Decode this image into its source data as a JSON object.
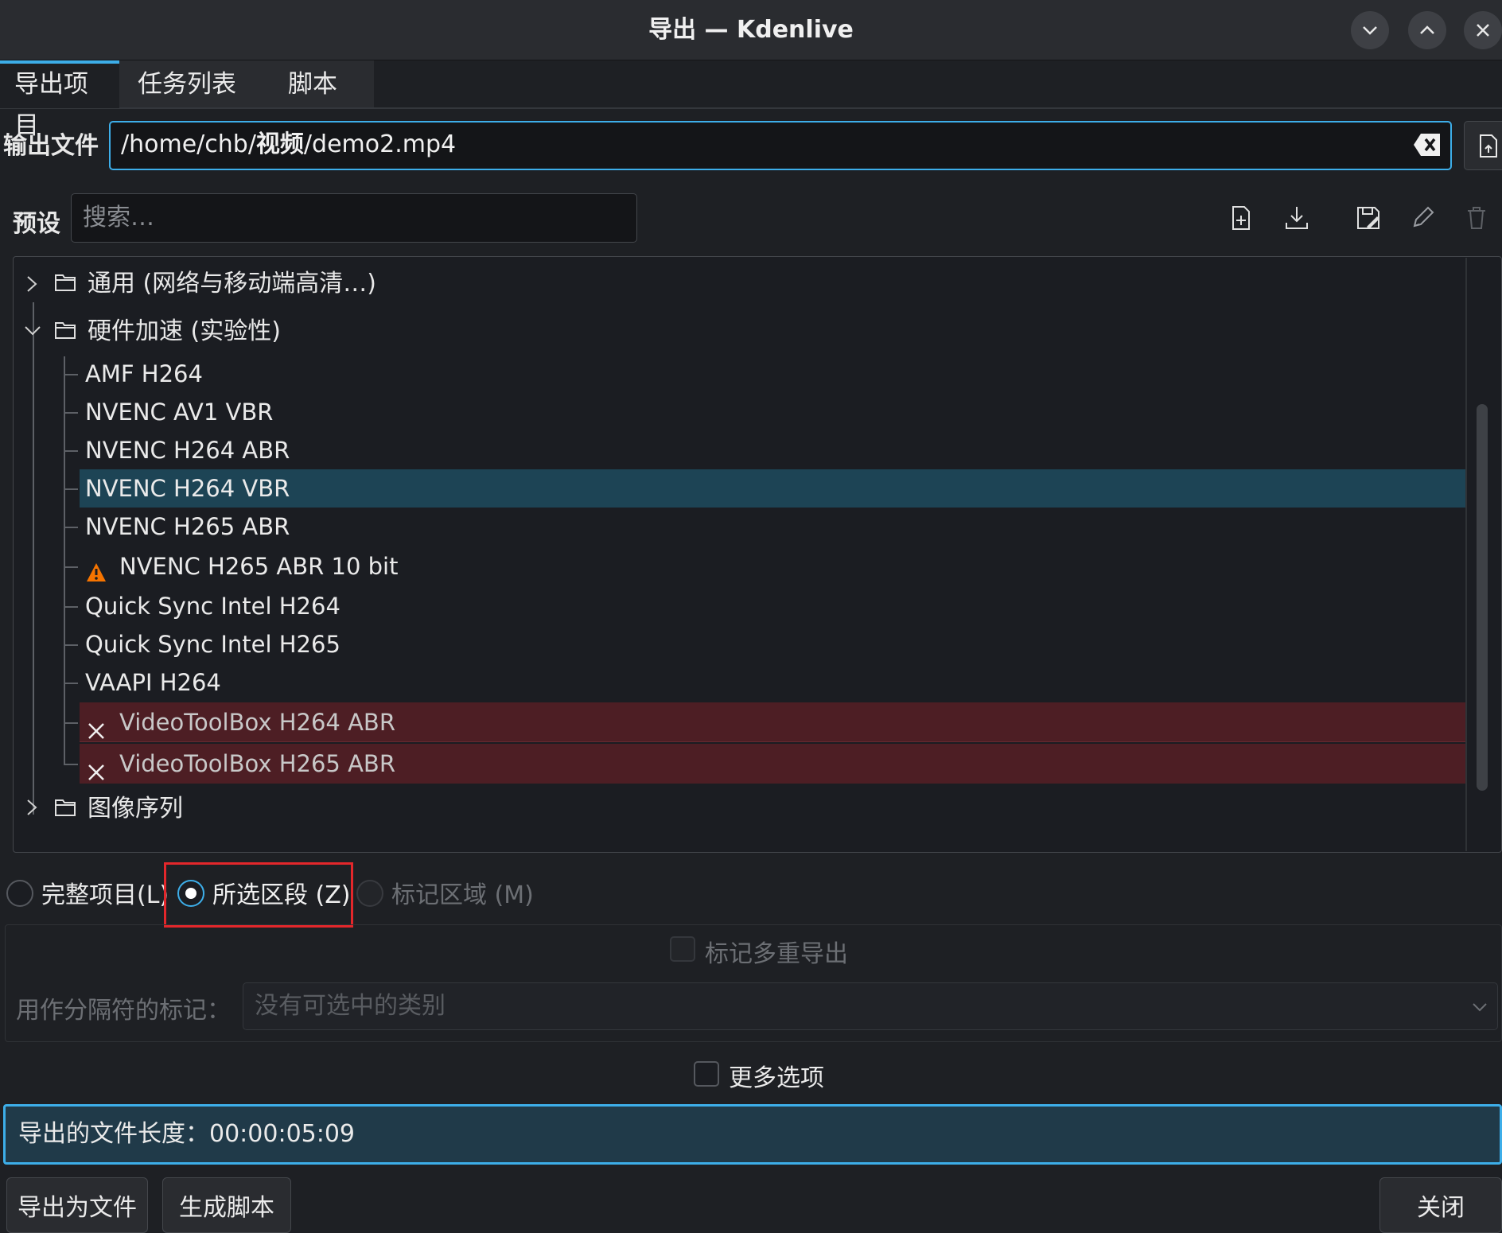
{
  "window": {
    "title": "导出 — Kdenlive"
  },
  "tabs": [
    {
      "label": "导出项目",
      "active": true
    },
    {
      "label": "任务列表",
      "active": false
    },
    {
      "label": "脚本",
      "active": false
    }
  ],
  "output": {
    "label": "输出文件",
    "path_prefix": "/home/chb/",
    "path_folder": "视频",
    "path_suffix": "/demo2.mp4"
  },
  "presets": {
    "label": "预设",
    "search_placeholder": "搜索…",
    "toolbar_icons": [
      "new-preset-icon",
      "download-preset-icon",
      "save-preset-icon",
      "edit-preset-icon",
      "delete-preset-icon"
    ]
  },
  "tree": {
    "folders": [
      {
        "label": "通用 (网络与移动端高清…)",
        "expanded": false
      },
      {
        "label": "硬件加速 (实验性)",
        "expanded": true
      },
      {
        "label": "图像序列",
        "expanded": false
      }
    ],
    "items": [
      {
        "label": "AMF H264",
        "state": "normal"
      },
      {
        "label": "NVENC AV1 VBR",
        "state": "normal"
      },
      {
        "label": "NVENC H264 ABR",
        "state": "normal"
      },
      {
        "label": "NVENC H264 VBR",
        "state": "selected"
      },
      {
        "label": "NVENC H265 ABR",
        "state": "normal"
      },
      {
        "label": "NVENC H265 ABR 10 bit",
        "state": "warning"
      },
      {
        "label": "Quick Sync Intel H264",
        "state": "normal"
      },
      {
        "label": "Quick Sync Intel H265",
        "state": "normal"
      },
      {
        "label": "VAAPI H264",
        "state": "normal"
      },
      {
        "label": "VideoToolBox H264 ABR",
        "state": "error"
      },
      {
        "label": "VideoToolBox H265 ABR",
        "state": "error"
      }
    ]
  },
  "range": {
    "full_project": "完整项目(L)",
    "selected_zone": "所选区段 (Z)",
    "guide_region": "标记区域 (M)",
    "selected": "selected_zone"
  },
  "markers": {
    "multi_export": "标记多重导出",
    "separator_label": "用作分隔符的标记：",
    "separator_value": "没有可选中的类别"
  },
  "more_options": "更多选项",
  "duration": {
    "label": "导出的文件长度：",
    "value": "00:00:05:09"
  },
  "buttons": {
    "export": "导出为文件",
    "script": "生成脚本",
    "close": "关闭"
  },
  "colors": {
    "accent": "#3daee9",
    "selection": "#1d4455",
    "error_row": "#4d1e24",
    "warning": "#f67400",
    "highlight_box": "#e3272b"
  }
}
